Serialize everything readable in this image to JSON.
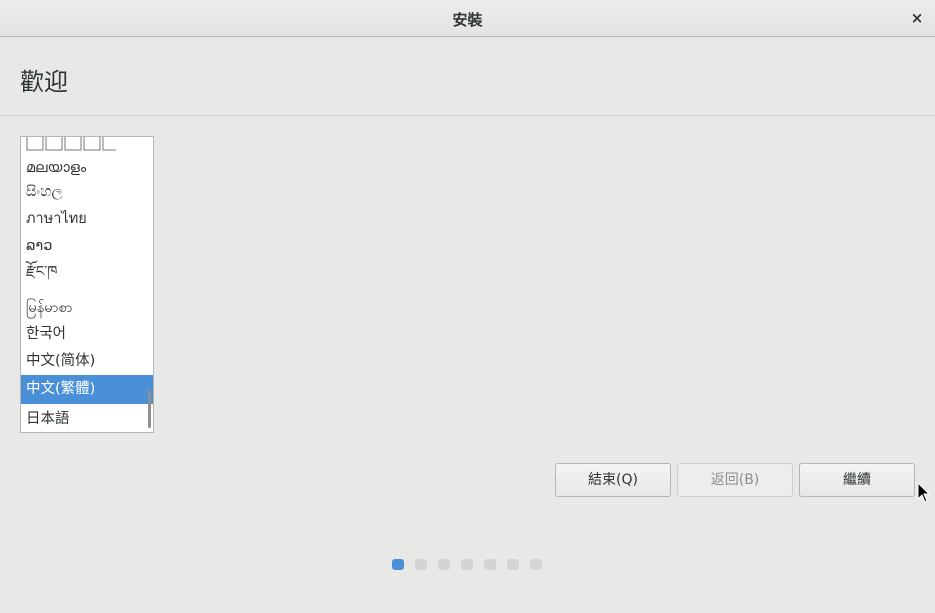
{
  "window": {
    "title": "安裝",
    "close_symbol": "×"
  },
  "page": {
    "heading": "歡迎"
  },
  "language_list": {
    "items": [
      {
        "label": "",
        "glyph_row": true
      },
      {
        "label": "മലയാളം"
      },
      {
        "label": "සිංහල"
      },
      {
        "label": "ภาษาไทย"
      },
      {
        "label": "ລາວ"
      },
      {
        "label": "རྫོང་ཁ"
      },
      {
        "label": "မြန်မာစာ"
      },
      {
        "label": "한국어"
      },
      {
        "label": "中文(简体)"
      },
      {
        "label": "中文(繁體)",
        "selected": true
      },
      {
        "label": "日本語"
      }
    ]
  },
  "buttons": {
    "quit": {
      "label": "結束(Q)",
      "enabled": true
    },
    "back": {
      "label": "返回(B)",
      "enabled": false
    },
    "continue": {
      "label": "繼續",
      "enabled": true
    }
  },
  "progress": {
    "total_steps": 7,
    "current_step": 1
  },
  "colors": {
    "accent": "#4a90d9",
    "background": "#e8e8e7",
    "list_bg": "#ffffff"
  },
  "icons": {
    "close": "close-icon",
    "cursor": "mouse-pointer-icon"
  }
}
